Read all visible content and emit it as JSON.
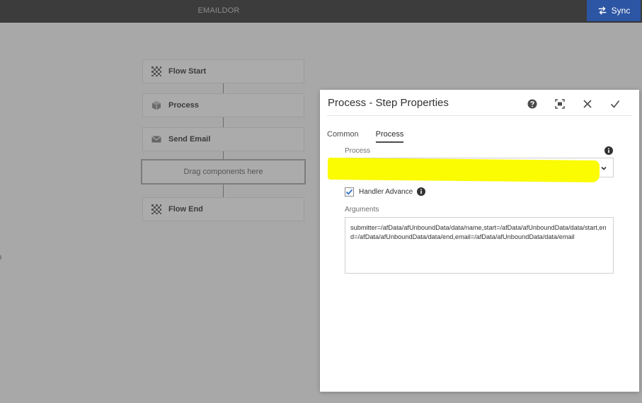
{
  "topbar": {
    "title": "EMAILDOR",
    "sync_label": "Sync"
  },
  "workflow": {
    "nodes": [
      {
        "label": "Flow Start",
        "icon": "flow-start-icon"
      },
      {
        "label": "Process",
        "icon": "process-icon"
      },
      {
        "label": "Send Email",
        "icon": "email-icon"
      },
      {
        "label": "Flow End",
        "icon": "flow-end-icon"
      }
    ],
    "dropzone_label": "Drag components here"
  },
  "dialog": {
    "title": "Process - Step Properties",
    "tabs": [
      {
        "label": "Common",
        "active": false
      },
      {
        "label": "Process",
        "active": true
      }
    ],
    "process_label": "Process",
    "process_value": "",
    "handler_advance_label": "Handler Advance",
    "handler_advance_checked": true,
    "arguments_label": "Arguments",
    "arguments_value": "submitter=/afData/afUnboundData/data/name,start=/afData/afUnboundData/data/start,end=/afData/afUnboundData/data/end,email=/afData/afUnboundData/data/email",
    "highlight_color": "#fbfb02"
  },
  "colors": {
    "topbar": "#3c3c3c",
    "sync_button": "#2c55a4",
    "canvas": "#a8a8a8"
  }
}
